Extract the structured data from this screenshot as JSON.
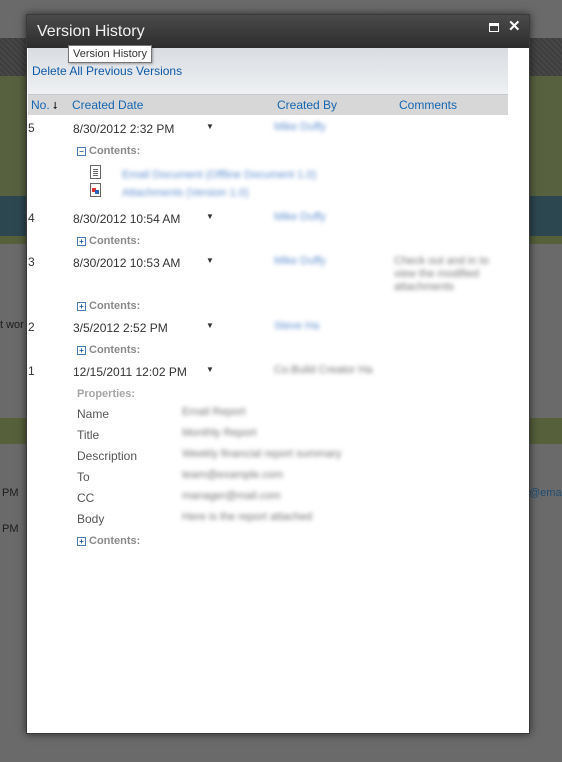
{
  "dialog": {
    "title": "Version History",
    "tooltip": "Version History",
    "delete_link": "Delete All Previous Versions"
  },
  "columns": {
    "no": "No.",
    "created_date": "Created Date",
    "created_by": "Created By",
    "comments": "Comments"
  },
  "versions": [
    {
      "no": "5",
      "date": "8/30/2012 2:32 PM",
      "by": "Mike Duffy",
      "comment": "",
      "contents_label": "Contents:",
      "files": [
        "Email Document (Offline Document 1.0)",
        "Attachments (Version 1.0)"
      ]
    },
    {
      "no": "4",
      "date": "8/30/2012 10:54 AM",
      "by": "Mike Duffy",
      "comment": "",
      "contents_label": "Contents:"
    },
    {
      "no": "3",
      "date": "8/30/2012 10:53 AM",
      "by": "Mike Duffy",
      "comment_lines": [
        "Check out and in to",
        "view the modified",
        "attachments"
      ],
      "contents_label": "Contents:"
    },
    {
      "no": "2",
      "date": "3/5/2012 2:52 PM",
      "by": "Steve Ha",
      "comment": "",
      "contents_label": "Contents:"
    },
    {
      "no": "1",
      "date": "12/15/2011 12:02 PM",
      "by": "Co.Build Creator Ha",
      "comment": "",
      "properties_label": "Properties:",
      "properties": [
        {
          "label": "Name",
          "value": "Email Report"
        },
        {
          "label": "Title",
          "value": "Monthly Report"
        },
        {
          "label": "Description",
          "value": "Weekly financial report summary"
        },
        {
          "label": "To",
          "value": "team@example.com"
        },
        {
          "label": "CC",
          "value": "manager@mail.com"
        },
        {
          "label": "Body",
          "value": "Here is the report attached"
        }
      ],
      "contents_label": "Contents:"
    }
  ],
  "background": {
    "t_wor": "t wor",
    "pm1": "PM",
    "pm2": "PM",
    "email": "@ema"
  },
  "icons": {
    "sort": "sort-descending-icon",
    "maximize": "maximize-icon",
    "close": "close-icon"
  }
}
